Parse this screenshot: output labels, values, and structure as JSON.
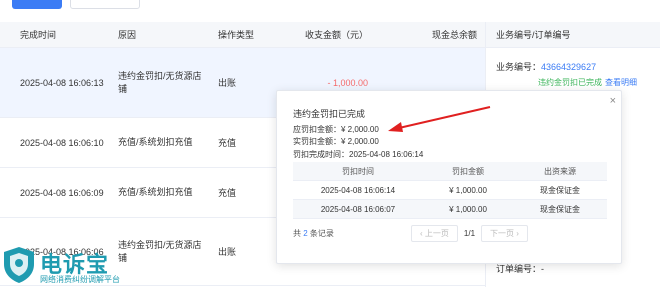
{
  "toolbar": {
    "primary_label": "",
    "secondary_label": ""
  },
  "table": {
    "headers": [
      "完成时间",
      "原因",
      "操作类型",
      "收支金额（元）",
      "现金总余额"
    ],
    "rows": [
      {
        "time": "2025-04-08 16:06:13",
        "reason": "违约金罚扣/无货源店铺",
        "type": "出账",
        "amount": "- 1,000.00",
        "highlight": true
      },
      {
        "time": "2025-04-08 16:06:10",
        "reason": "充值/系统划扣充值",
        "type": "充值",
        "amount": "",
        "highlight": false
      },
      {
        "time": "2025-04-08 16:06:09",
        "reason": "充值/系统划扣充值",
        "type": "充值",
        "amount": "",
        "highlight": false
      },
      {
        "time": "2025-04-08 16:06:06",
        "reason": "违约金罚扣/无货源店铺",
        "type": "出账",
        "amount": "",
        "highlight": false
      }
    ]
  },
  "right_panel": {
    "header": "业务编号/订单编号",
    "order_label": "业务编号：",
    "order_no": "43664329627",
    "status": "违约金罚扣已完成",
    "link": "查看明细",
    "footer": "订单编号：-"
  },
  "popup": {
    "title": "违约金罚扣已完成",
    "payable_label": "应罚扣金额：",
    "payable": "¥ 2,000.00",
    "actual_label": "实罚扣金额：",
    "actual": "¥ 2,000.00",
    "done_label": "罚扣完成时间：",
    "done_time": "2025-04-08 16:06:14",
    "columns": [
      "罚扣时间",
      "罚扣金额",
      "出资来源"
    ],
    "rows": [
      {
        "time": "2025-04-08 16:06:14",
        "amount": "¥ 1,000.00",
        "source": "现金保证金"
      },
      {
        "time": "2025-04-08 16:06:07",
        "amount": "¥ 1,000.00",
        "source": "现金保证金"
      }
    ],
    "total_prefix": "共",
    "total_count": "2",
    "total_suffix": "条记录",
    "prev": "上一页",
    "page": "1/1",
    "next": "下一页",
    "close": "×"
  },
  "watermark": {
    "brand": "电诉宝",
    "slogan": "网络消费纠纷调解平台"
  },
  "colors": {
    "accent": "#3b7cf5",
    "negative": "#f56c6c",
    "success": "#3bb55a",
    "arrow": "#e02020",
    "brand": "#1f9bb0"
  }
}
